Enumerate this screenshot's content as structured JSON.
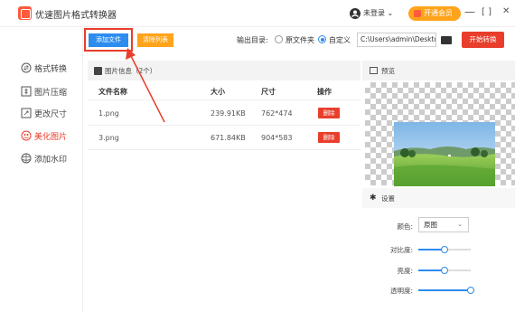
{
  "window": {
    "title": "优速图片格式转换器",
    "user_label": "未登录",
    "vip_label": "开通会员",
    "minimize": "—",
    "maximize": "[ ]",
    "close": "✕"
  },
  "sidebar": {
    "items": [
      {
        "label": "格式转换",
        "icon": "convert-icon",
        "active": false
      },
      {
        "label": "图片压缩",
        "icon": "compress-icon",
        "active": false
      },
      {
        "label": "更改尺寸",
        "icon": "resize-icon",
        "active": false
      },
      {
        "label": "美化图片",
        "icon": "beautify-icon",
        "active": true
      },
      {
        "label": "添加水印",
        "icon": "watermark-icon",
        "active": false
      }
    ]
  },
  "toolbar": {
    "add_label": "添加文件",
    "clear_label": "清除列表",
    "output_label": "输出目录:",
    "radio_original": "原文件夹",
    "radio_custom": "自定义",
    "path_value": "C:\\Users\\admin\\Deskto",
    "start_label": "开始转换"
  },
  "file_panel": {
    "header": "图片信息（2个）",
    "columns": [
      "文件名称",
      "大小",
      "尺寸",
      "操作"
    ],
    "rows": [
      {
        "name": "1.png",
        "size": "239.91KB",
        "dims": "762*474",
        "action": "删除"
      },
      {
        "name": "3.png",
        "size": "671.84KB",
        "dims": "904*583",
        "action": "删除"
      }
    ]
  },
  "preview": {
    "header": "预览"
  },
  "settings": {
    "header": "设置",
    "color_label": "颜色:",
    "color_value": "原图",
    "contrast_label": "对比度:",
    "brightness_label": "亮度:",
    "opacity_label": "透明度:",
    "contrast_value": 0.5,
    "brightness_value": 0.5,
    "opacity_value": 1.0
  },
  "colors": {
    "accent_blue": "#2d8cf0",
    "accent_red": "#e83e2b",
    "accent_orange": "#ffa31a"
  }
}
